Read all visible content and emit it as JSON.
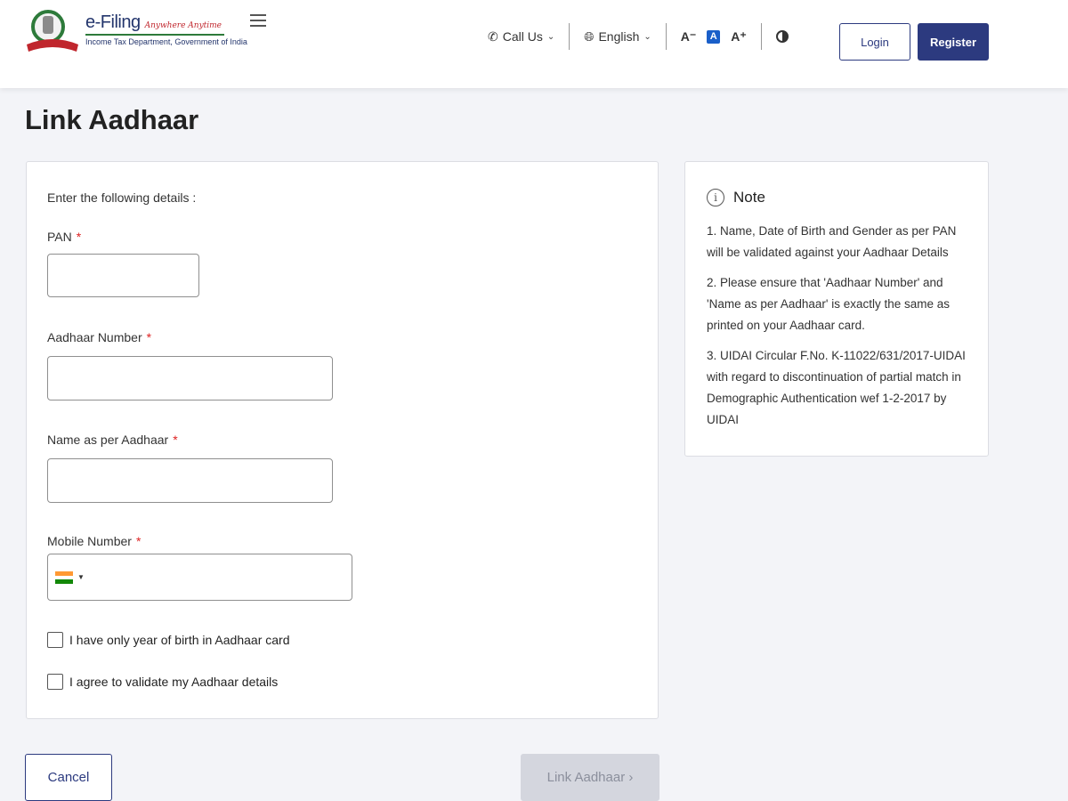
{
  "header": {
    "brand_name": "e-Filing",
    "brand_tagline": "Anywhere Anytime",
    "brand_sub": "Income Tax Department, Government of India",
    "call_us": "Call Us",
    "language": "English",
    "font_small": "A⁻",
    "font_default": "A",
    "font_large": "A⁺",
    "login_label": "Login",
    "register_label": "Register"
  },
  "page": {
    "title": "Link Aadhaar"
  },
  "form": {
    "intro": "Enter the following details :",
    "required_mark": "*",
    "pan_label": "PAN",
    "pan_value": "",
    "aadhaar_label": "Aadhaar Number",
    "aadhaar_value": "",
    "name_label": "Name as per Aadhaar",
    "name_value": "",
    "mobile_label": "Mobile Number",
    "mobile_value": "",
    "checkbox_yob": "I have only year of birth in Aadhaar card",
    "checkbox_agree": "I agree to validate my Aadhaar details"
  },
  "note": {
    "title": "Note",
    "items": [
      "1. Name, Date of Birth and Gender as per PAN will be validated against your Aadhaar Details",
      "2. Please ensure that 'Aadhaar Number' and 'Name as per Aadhaar' is exactly the same as printed on your Aadhaar card.",
      "3. UIDAI Circular F.No. K-11022/631/2017-UIDAI with regard to discontinuation of partial match in Demographic Authentication wef 1-2-2017 by UIDAI"
    ]
  },
  "actions": {
    "cancel_label": "Cancel",
    "link_label": "Link Aadhaar  ›"
  },
  "colors": {
    "primary": "#2c3a7f",
    "required": "#dd2222",
    "disabled_bg": "#d4d6de"
  },
  "icons": [
    "emblem-icon",
    "menu-icon",
    "phone-icon",
    "globe-icon",
    "chevron-down-icon",
    "contrast-icon",
    "info-icon",
    "india-flag-icon"
  ]
}
